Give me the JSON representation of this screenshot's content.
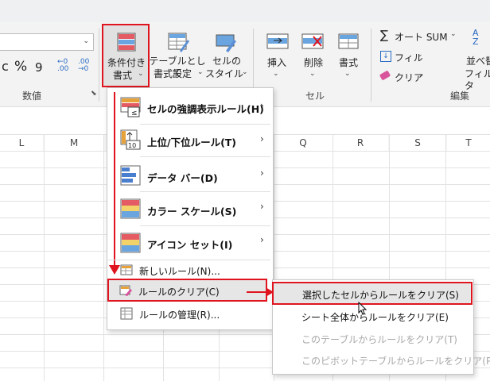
{
  "ribbon": {
    "number_format_pct": "%",
    "number_format_comma": "9",
    "dec_increase": "←0\n.00",
    "dec_decrease": ".00\n→0",
    "group_number": "数値",
    "cond_format_line1": "条件付き",
    "cond_format_line2": "書式",
    "table_format_line1": "テーブルとして",
    "table_format_line2": "書式設定",
    "cell_style_line1": "セルの",
    "cell_style_line2": "スタイル",
    "insert": "挿入",
    "delete": "削除",
    "format": "書式",
    "group_cells": "セル",
    "autosum": "オート SUM",
    "fill": "フィル",
    "clear": "クリア",
    "sort_line1": "並べ替",
    "sort_line2": "フィルタ",
    "group_edit": "編集",
    "sigma": "∑"
  },
  "columns": [
    "L",
    "M",
    "Q",
    "R",
    "S",
    "T"
  ],
  "menu": {
    "items": [
      {
        "label": "セルの強調表示ルール(H)"
      },
      {
        "label": "上位/下位ルール(T)"
      },
      {
        "label": "データ バー(D)"
      },
      {
        "label": "カラー スケール(S)"
      },
      {
        "label": "アイコン セット(I)"
      },
      {
        "label": "新しいルール(N)..."
      },
      {
        "label": "ルールのクリア(C)"
      },
      {
        "label": "ルールの管理(R)..."
      }
    ]
  },
  "submenu": {
    "items": [
      {
        "label": "選択したセルからルールをクリア(S)",
        "enabled": true
      },
      {
        "label": "シート全体からルールをクリア(E)",
        "enabled": true
      },
      {
        "label": "このテーブルからルールをクリア(T)",
        "enabled": false
      },
      {
        "label": "このピボットテーブルからルールをクリア(P)",
        "enabled": false
      }
    ]
  },
  "colors": {
    "highlight_red": "#e0141e",
    "menu_hover": "#e8e8e8",
    "accent_blue": "#2b6cc4"
  }
}
